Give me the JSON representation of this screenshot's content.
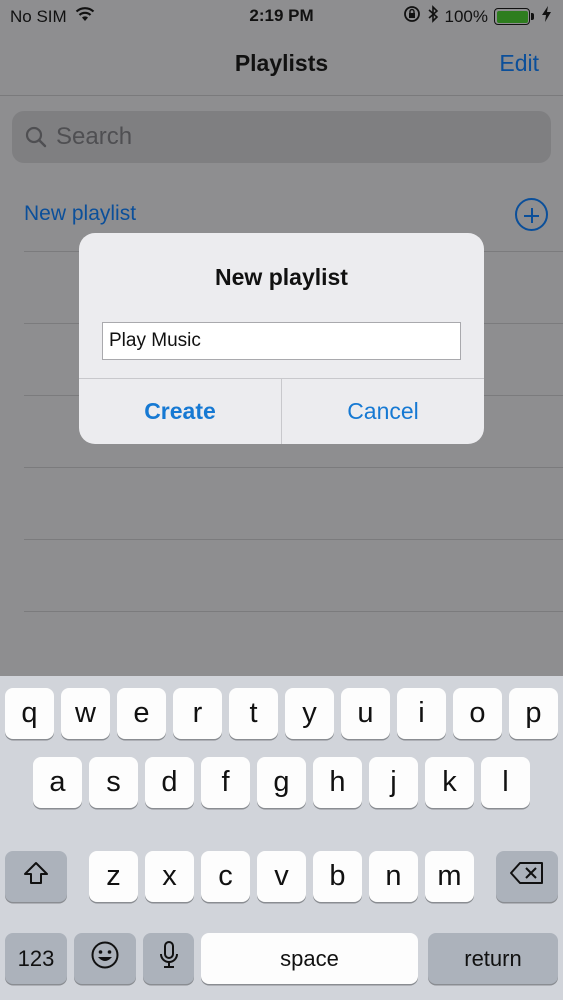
{
  "status_bar": {
    "carrier": "No SIM",
    "time": "2:19 PM",
    "battery_percent": "100%",
    "battery_level": 1.0,
    "icons": [
      "wifi-icon",
      "orientation-lock-icon",
      "bluetooth-icon",
      "battery-icon",
      "charging-bolt-icon"
    ]
  },
  "navbar": {
    "title": "Playlists",
    "edit_label": "Edit"
  },
  "search": {
    "placeholder": "Search"
  },
  "list": {
    "new_playlist_label": "New playlist"
  },
  "dialog": {
    "title": "New playlist",
    "input_value": "Play Music",
    "create_label": "Create",
    "cancel_label": "Cancel"
  },
  "keyboard": {
    "row1": [
      "q",
      "w",
      "e",
      "r",
      "t",
      "y",
      "u",
      "i",
      "o",
      "p"
    ],
    "row2": [
      "a",
      "s",
      "d",
      "f",
      "g",
      "h",
      "j",
      "k",
      "l"
    ],
    "row3": [
      "z",
      "x",
      "c",
      "v",
      "b",
      "n",
      "m"
    ],
    "numbers_label": "123",
    "space_label": "space",
    "return_label": "return"
  },
  "colors": {
    "accent": "#1679d3",
    "dimmed_accent": "#0b4f9a",
    "keyboard_bg": "#d1d4da"
  }
}
